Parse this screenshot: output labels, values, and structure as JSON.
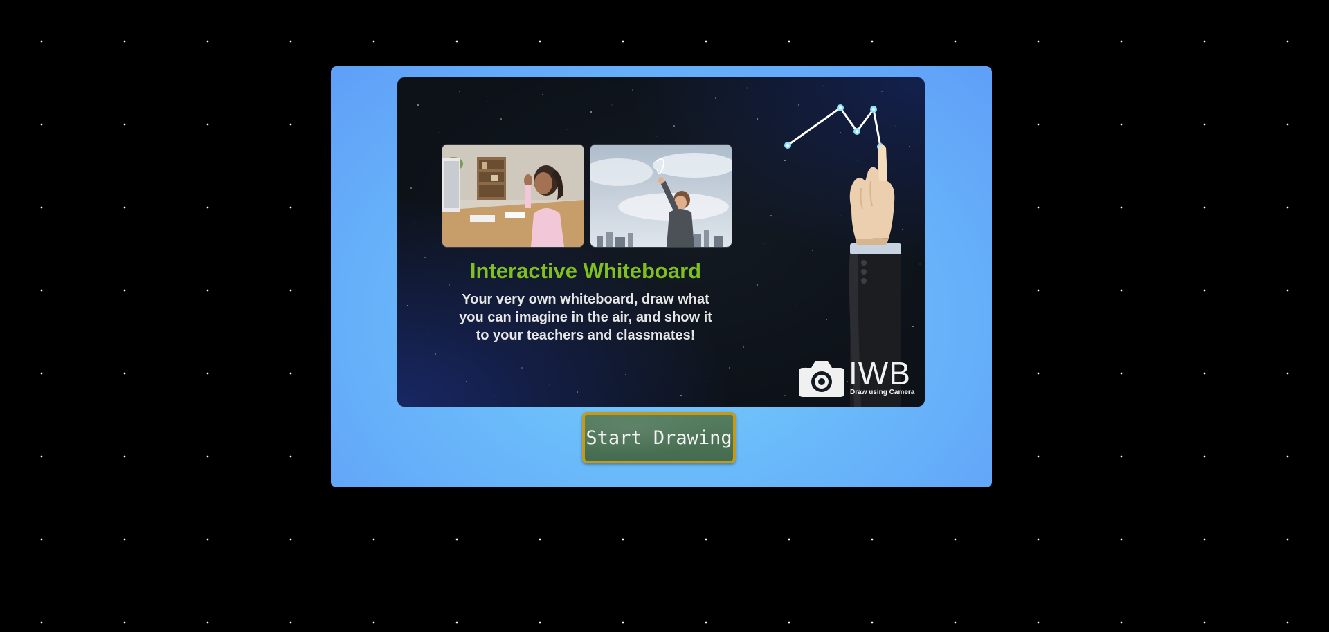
{
  "banner": {
    "headline": "Interactive Whiteboard",
    "description": "Your very own whiteboard, draw what you can imagine in the air, and show it to your teachers and classmates!",
    "headline_color": "#7fbf1f",
    "photos": [
      {
        "subject": "girl waving at computer"
      },
      {
        "subject": "boy drawing in the sky"
      }
    ]
  },
  "logo": {
    "text": "IWB",
    "tagline": "Draw using Camera",
    "icon": "camera-icon"
  },
  "actions": {
    "start_label": "Start Drawing"
  },
  "colors": {
    "stage_background": "#6bbcfa",
    "button_background": "#4f7459",
    "button_border": "#c49a1c"
  }
}
